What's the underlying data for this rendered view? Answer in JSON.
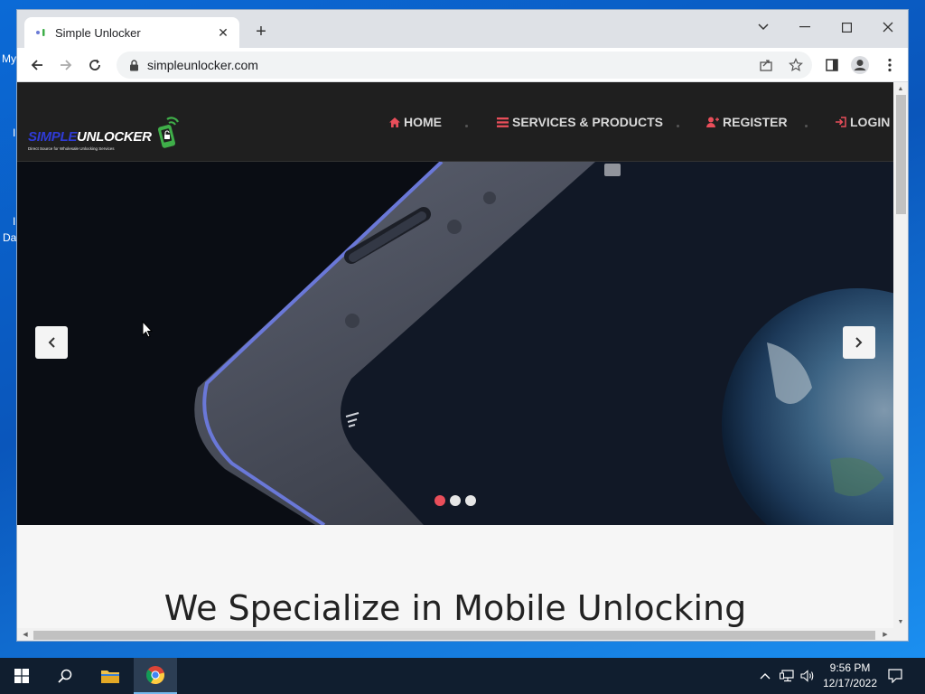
{
  "desktop": {
    "fragments": [
      "My",
      "I",
      "I",
      "Da"
    ]
  },
  "browser": {
    "tab": {
      "title": "Simple Unlocker",
      "close_glyph": "✕"
    },
    "new_tab_glyph": "+",
    "address": {
      "url": "simpleunlocker.com"
    }
  },
  "site": {
    "logo": {
      "part1": "SIMPLE",
      "part2": "UNLOCKER",
      "tagline": "Direct Source for Wholesale Unlocking Services"
    },
    "nav": [
      {
        "label": "HOME",
        "icon": "home-icon"
      },
      {
        "label": "SERVICES & PRODUCTS",
        "icon": "list-icon"
      },
      {
        "label": "REGISTER",
        "icon": "user-plus-icon"
      },
      {
        "label": "LOGIN",
        "icon": "sign-in-icon"
      }
    ],
    "carousel": {
      "slides": 3,
      "active_index": 0
    },
    "headline": "We Specialize in Mobile Unlocking"
  },
  "taskbar": {
    "time": "9:56 PM",
    "date": "12/17/2022"
  },
  "colors": {
    "accent_red": "#e94e5a",
    "header_bg": "#1f1f1f",
    "logo_blue": "#2f3bd6",
    "logo_green": "#3fae49"
  }
}
